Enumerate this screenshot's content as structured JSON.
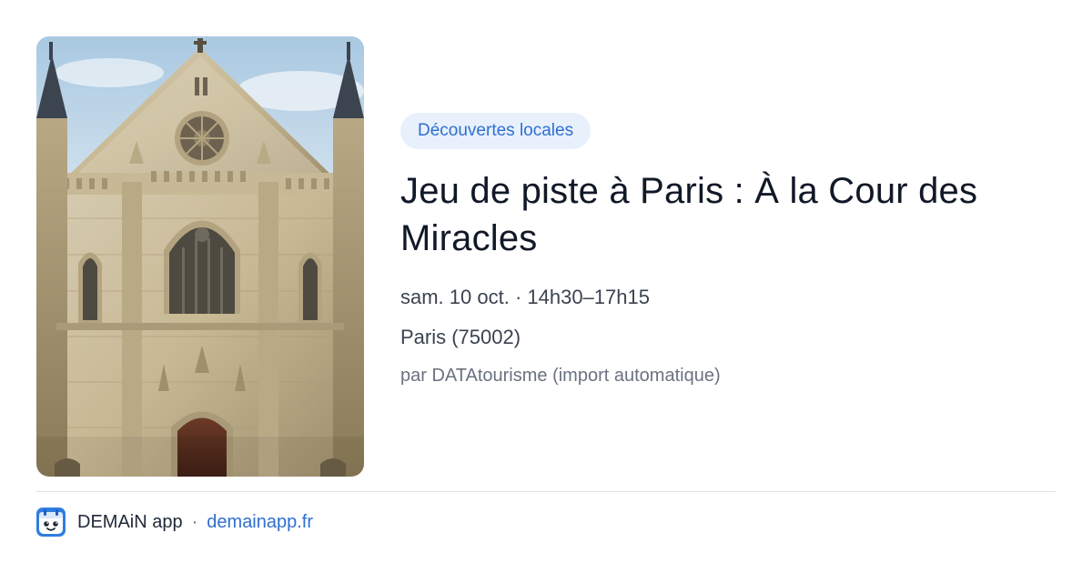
{
  "card": {
    "category": "Découvertes locales",
    "title": "Jeu de piste à Paris : À la Cour des Miracles",
    "date_time": "sam. 10 oct. · 14h30–17h15",
    "location": "Paris (75002)",
    "source": "par DATAtourisme (import automatique)"
  },
  "footer": {
    "app_name": "DEMAiN app",
    "separator": "·",
    "domain": "demainapp.fr",
    "logo_icon": "demain-app-logo-icon"
  },
  "colors": {
    "accent": "#2f6fd0",
    "chip_background": "#e8f0fc",
    "title_text": "#111827",
    "muted_text": "#6b7280"
  }
}
